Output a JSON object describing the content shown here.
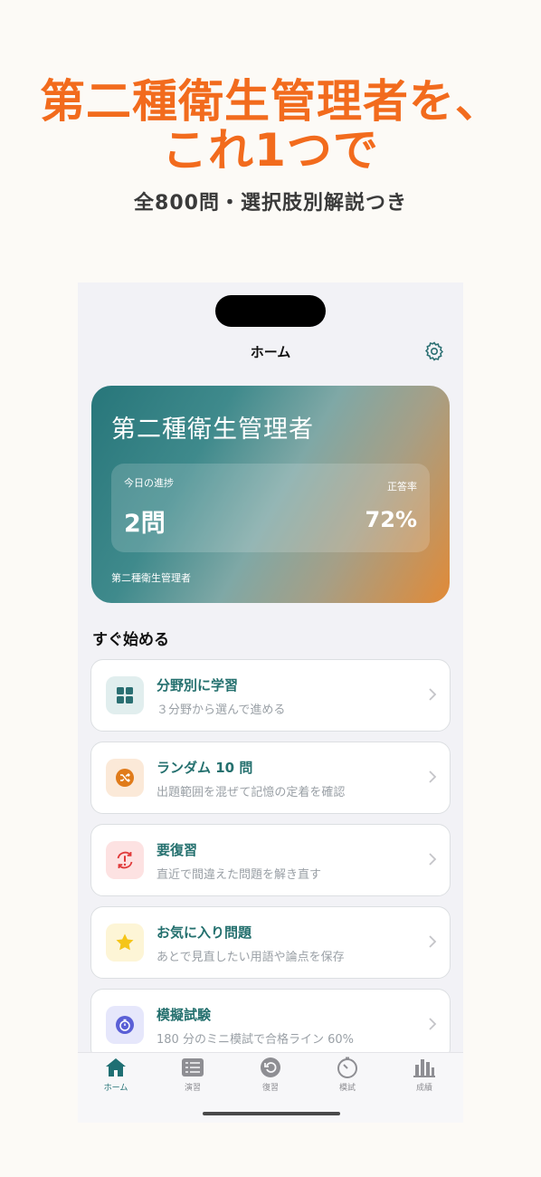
{
  "promo": {
    "headline_line1": "第二種衛生管理者を、",
    "headline_line2": "これ1つで",
    "subtitle": "全800問・選択肢別解説つき"
  },
  "nav": {
    "title": "ホーム",
    "settings_icon": "gear-icon"
  },
  "hero": {
    "title": "第二種衛生管理者",
    "progress_label": "今日の進捗",
    "progress_value": "2問",
    "accuracy_label": "正答率",
    "accuracy_value": "72%",
    "footer": "第二種衛生管理者"
  },
  "section_title": "すぐ始める",
  "menu": [
    {
      "title": "分野別に学習",
      "subtitle": "３分野から選んで進める",
      "icon": "grid-icon",
      "color": "#2a6f72"
    },
    {
      "title": "ランダム 10 問",
      "subtitle": "出題範囲を混ぜて記憶の定着を確認",
      "icon": "shuffle-icon",
      "color": "#e07b1a"
    },
    {
      "title": "要復習",
      "subtitle": "直近で間違えた問題を解き直す",
      "icon": "review-alert-icon",
      "color": "#e03a3a"
    },
    {
      "title": "お気に入り問題",
      "subtitle": "あとで見直したい用語や論点を保存",
      "icon": "star-icon",
      "color": "#f5c518"
    },
    {
      "title": "模擬試験",
      "subtitle": "180 分のミニ模試で合格ライン 60%",
      "icon": "timer-icon",
      "color": "#5a5fd6"
    }
  ],
  "tabs": [
    {
      "label": "ホーム",
      "icon": "home-icon",
      "active": true
    },
    {
      "label": "演習",
      "icon": "list-icon"
    },
    {
      "label": "復習",
      "icon": "rewind-icon"
    },
    {
      "label": "模試",
      "icon": "stopwatch-icon"
    },
    {
      "label": "成績",
      "icon": "bar-chart-icon"
    }
  ],
  "colors": {
    "accent": "#f26b1d",
    "brand": "#24706e"
  }
}
